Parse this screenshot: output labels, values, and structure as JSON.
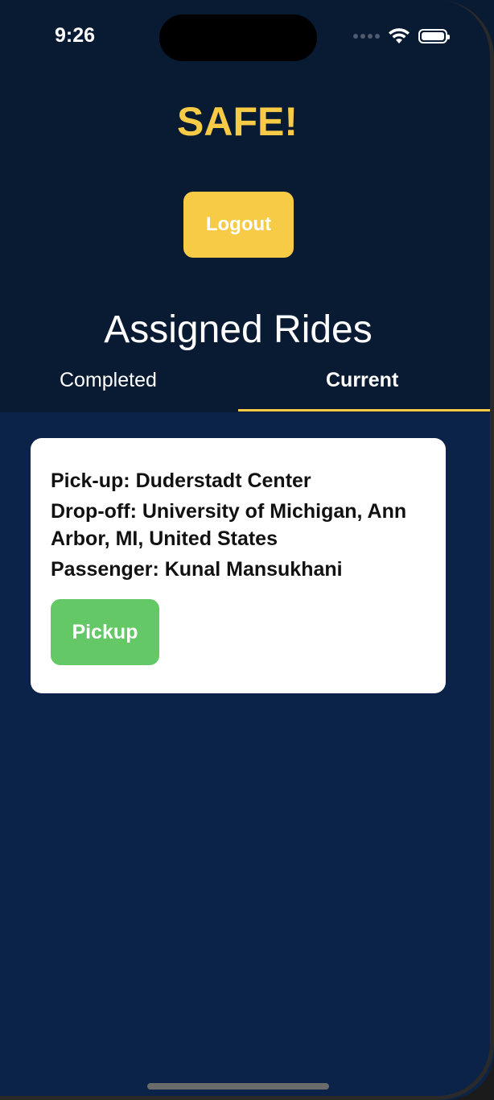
{
  "status_bar": {
    "time": "9:26",
    "icons": [
      "signal-dots-icon",
      "wifi-icon",
      "battery-icon"
    ]
  },
  "app": {
    "title": "SAFE!",
    "logout_label": "Logout",
    "section_title": "Assigned Rides"
  },
  "tabs": [
    {
      "label": "Completed",
      "active": false
    },
    {
      "label": "Current",
      "active": true
    }
  ],
  "rides": [
    {
      "pickup": "Pick-up: Duderstadt Center",
      "dropoff": "Drop-off: University of Michigan, Ann Arbor, MI, United States",
      "passenger": "Passenger: Kunal Mansukhani",
      "action_label": "Pickup"
    }
  ],
  "colors": {
    "accent": "#f7cb46",
    "background": "#0c2349",
    "header_background": "#091a33",
    "card": "#ffffff",
    "action": "#64c867"
  }
}
